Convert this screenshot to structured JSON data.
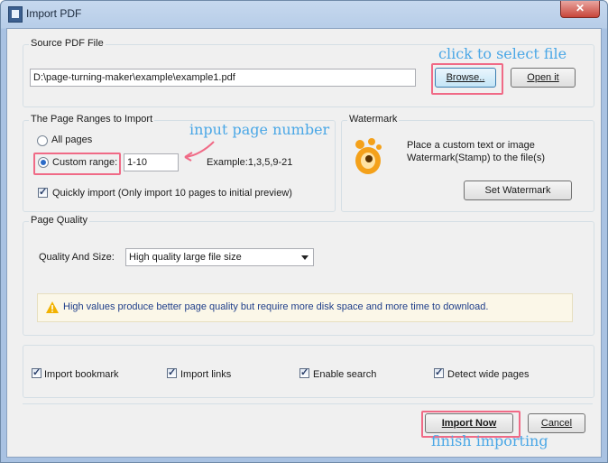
{
  "window": {
    "title": "Import PDF",
    "close_glyph": "✕"
  },
  "source": {
    "group_label": "Source PDF File",
    "path_value": "D:\\page-turning-maker\\example\\example1.pdf",
    "browse_label": "Browse..",
    "open_label": "Open it",
    "annotation": "click to select file"
  },
  "ranges": {
    "group_label": "The Page Ranges to Import",
    "all_pages_label": "All pages",
    "custom_range_label": "Custom range:",
    "custom_range_value": "1-10",
    "example_text": "Example:1,3,5,9-21",
    "quick_import_label": "Quickly import (Only import 10 pages to  initial  preview)",
    "annotation": "input page number"
  },
  "watermark": {
    "group_label": "Watermark",
    "description_line1": "Place a custom text or image",
    "description_line2": "Watermark(Stamp) to the file(s)",
    "set_button_label": "Set Watermark",
    "icon": "gimp-mascot-icon"
  },
  "quality": {
    "group_label": "Page Quality",
    "quality_label": "Quality And Size:",
    "selected_option": "High quality large file size",
    "warning_text": "High values produce better page quality but require more disk space and more time to download."
  },
  "options": [
    {
      "label": "Import bookmark",
      "checked": true
    },
    {
      "label": "Import links",
      "checked": true
    },
    {
      "label": "Enable search",
      "checked": true
    },
    {
      "label": "Detect wide pages",
      "checked": true
    }
  ],
  "footer": {
    "import_label": "Import Now",
    "cancel_label": "Cancel",
    "annotation": "finish importing"
  },
  "colors": {
    "annotation": "#4aa7e6",
    "highlight": "#f06a86",
    "accent": "#2b6bc7"
  }
}
